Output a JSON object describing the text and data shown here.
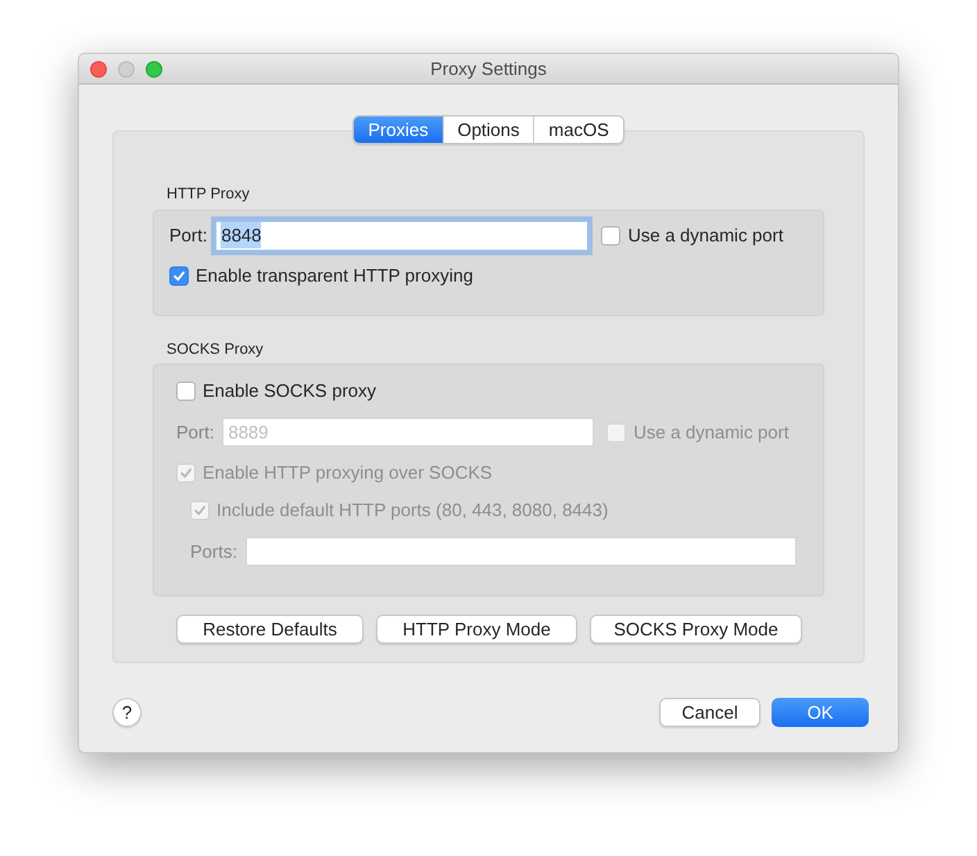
{
  "window": {
    "title": "Proxy Settings"
  },
  "tabs": [
    {
      "label": "Proxies",
      "selected": true
    },
    {
      "label": "Options",
      "selected": false
    },
    {
      "label": "macOS",
      "selected": false
    }
  ],
  "http_proxy": {
    "title": "HTTP Proxy",
    "port_label": "Port:",
    "port_value": "8848",
    "port_focused": true,
    "dynamic_port": {
      "label": "Use a dynamic port",
      "checked": false,
      "disabled": false
    },
    "transparent": {
      "label": "Enable transparent HTTP proxying",
      "checked": true,
      "disabled": false
    }
  },
  "socks_proxy": {
    "title": "SOCKS Proxy",
    "enable": {
      "label": "Enable SOCKS proxy",
      "checked": false,
      "disabled": false
    },
    "port_label": "Port:",
    "port_value": "8889",
    "port_disabled": true,
    "dynamic_port": {
      "label": "Use a dynamic port",
      "checked": false,
      "disabled": true
    },
    "http_over_socks": {
      "label": "Enable HTTP proxying over SOCKS",
      "checked": true,
      "disabled": true
    },
    "include_default_ports": {
      "label": "Include default HTTP ports (80, 443, 8080, 8443)",
      "checked": true,
      "disabled": true
    },
    "ports_label": "Ports:"
  },
  "mode_buttons": [
    "Restore Defaults",
    "HTTP Proxy Mode",
    "SOCKS Proxy Mode"
  ],
  "help_button": "?",
  "footer_buttons": [
    {
      "label": "Cancel",
      "primary": false
    },
    {
      "label": "OK",
      "primary": true
    }
  ]
}
